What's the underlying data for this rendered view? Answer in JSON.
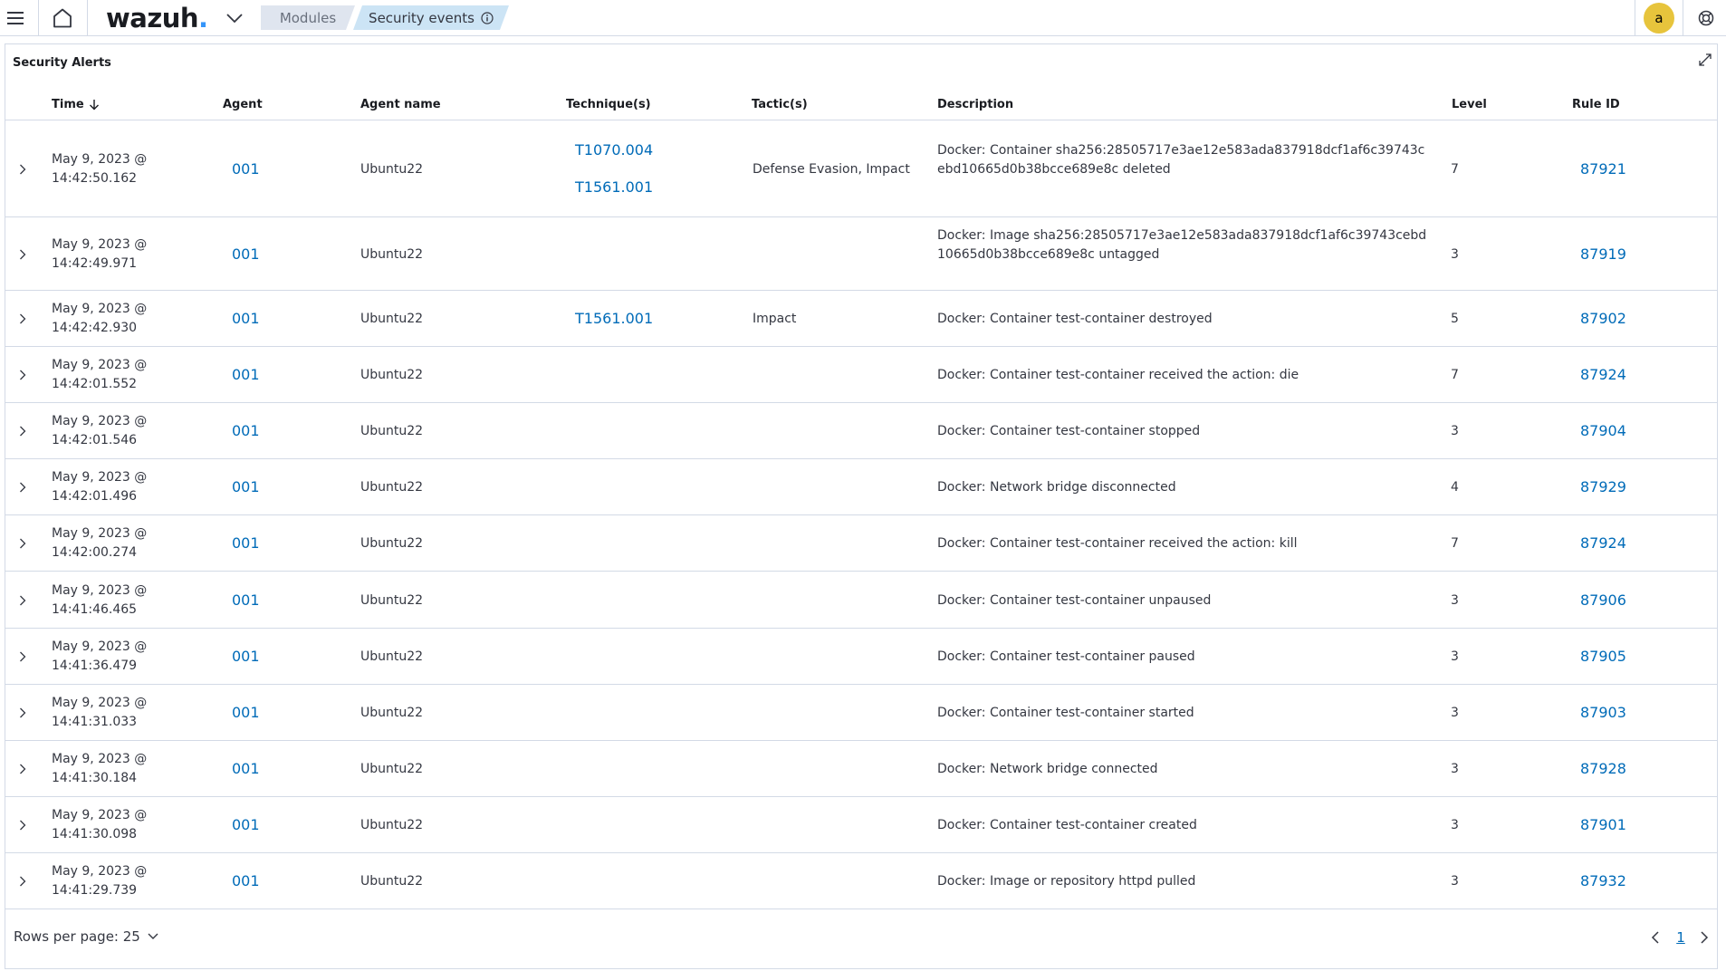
{
  "header": {
    "logo_text": "wazuh",
    "logo_dot": ".",
    "breadcrumbs": [
      "Modules",
      "Security events"
    ],
    "avatar_initial": "a"
  },
  "panel": {
    "title": "Security Alerts"
  },
  "table": {
    "columns": [
      "Time",
      "Agent",
      "Agent name",
      "Technique(s)",
      "Tactic(s)",
      "Description",
      "Level",
      "Rule ID"
    ],
    "rows": [
      {
        "time": "May 9, 2023 @ 14:42:50.162",
        "agent": "001",
        "agent_name": "Ubuntu22",
        "techniques": [
          "T1070.004",
          "T1561.001"
        ],
        "tactics": "Defense Evasion, Impact",
        "description": "Docker: Container sha256:28505717e3ae12e583ada837918dcf1af6c39743cebd10665d0b38bcce689e8c deleted",
        "level": "7",
        "rule_id": "87921"
      },
      {
        "time": "May 9, 2023 @ 14:42:49.971",
        "agent": "001",
        "agent_name": "Ubuntu22",
        "techniques": [],
        "tactics": "",
        "description": "Docker: Image sha256:28505717e3ae12e583ada837918dcf1af6c39743cebd10665d0b38bcce689e8c untagged",
        "level": "3",
        "rule_id": "87919"
      },
      {
        "time": "May 9, 2023 @ 14:42:42.930",
        "agent": "001",
        "agent_name": "Ubuntu22",
        "techniques": [
          "T1561.001"
        ],
        "tactics": "Impact",
        "description": "Docker: Container test-container destroyed",
        "level": "5",
        "rule_id": "87902"
      },
      {
        "time": "May 9, 2023 @ 14:42:01.552",
        "agent": "001",
        "agent_name": "Ubuntu22",
        "techniques": [],
        "tactics": "",
        "description": "Docker: Container test-container received the action: die",
        "level": "7",
        "rule_id": "87924"
      },
      {
        "time": "May 9, 2023 @ 14:42:01.546",
        "agent": "001",
        "agent_name": "Ubuntu22",
        "techniques": [],
        "tactics": "",
        "description": "Docker: Container test-container stopped",
        "level": "3",
        "rule_id": "87904"
      },
      {
        "time": "May 9, 2023 @ 14:42:01.496",
        "agent": "001",
        "agent_name": "Ubuntu22",
        "techniques": [],
        "tactics": "",
        "description": "Docker: Network bridge disconnected",
        "level": "4",
        "rule_id": "87929"
      },
      {
        "time": "May 9, 2023 @ 14:42:00.274",
        "agent": "001",
        "agent_name": "Ubuntu22",
        "techniques": [],
        "tactics": "",
        "description": "Docker: Container test-container received the action: kill",
        "level": "7",
        "rule_id": "87924"
      },
      {
        "time": "May 9, 2023 @ 14:41:46.465",
        "agent": "001",
        "agent_name": "Ubuntu22",
        "techniques": [],
        "tactics": "",
        "description": "Docker: Container test-container unpaused",
        "level": "3",
        "rule_id": "87906"
      },
      {
        "time": "May 9, 2023 @ 14:41:36.479",
        "agent": "001",
        "agent_name": "Ubuntu22",
        "techniques": [],
        "tactics": "",
        "description": "Docker: Container test-container paused",
        "level": "3",
        "rule_id": "87905"
      },
      {
        "time": "May 9, 2023 @ 14:41:31.033",
        "agent": "001",
        "agent_name": "Ubuntu22",
        "techniques": [],
        "tactics": "",
        "description": "Docker: Container test-container started",
        "level": "3",
        "rule_id": "87903"
      },
      {
        "time": "May 9, 2023 @ 14:41:30.184",
        "agent": "001",
        "agent_name": "Ubuntu22",
        "techniques": [],
        "tactics": "",
        "description": "Docker: Network bridge connected",
        "level": "3",
        "rule_id": "87928"
      },
      {
        "time": "May 9, 2023 @ 14:41:30.098",
        "agent": "001",
        "agent_name": "Ubuntu22",
        "techniques": [],
        "tactics": "",
        "description": "Docker: Container test-container created",
        "level": "3",
        "rule_id": "87901"
      },
      {
        "time": "May 9, 2023 @ 14:41:29.739",
        "agent": "001",
        "agent_name": "Ubuntu22",
        "techniques": [],
        "tactics": "",
        "description": "Docker: Image or repository httpd pulled",
        "level": "3",
        "rule_id": "87932"
      }
    ],
    "sort_column": "Time",
    "sort_direction": "descending"
  },
  "footer": {
    "rows_per_page_label": "Rows per page: 25",
    "current_page": "1"
  },
  "colors": {
    "link": "#006bb8",
    "breadcrumb_active_bg": "#cce4f5",
    "breadcrumb_bg": "#dfe5ef",
    "avatar_bg": "#e7c43c",
    "logo_dot": "#3595f9",
    "border": "#d3dae6"
  }
}
